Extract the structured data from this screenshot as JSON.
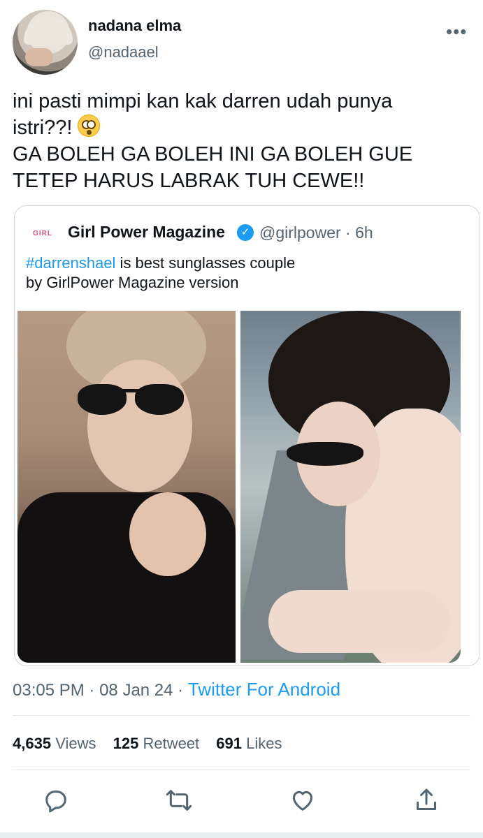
{
  "author": {
    "name": "nadana elma",
    "handle": "@nadaael"
  },
  "more_icon": "more-dots-icon",
  "tweet": {
    "line1": "ini pasti mimpi kan kak darren udah punya",
    "line2": "istri??!",
    "emoji": "flushed-face-emoji",
    "line3": "GA BOLEH GA BOLEH INI GA BOLEH GUE",
    "line4": "TETEP HARUS LABRAK TUH CEWE!!"
  },
  "quote": {
    "logo_text": "GIRL",
    "name": "Girl Power Magazine",
    "verified_icon": "verified-badge-icon",
    "handle_time": "@girlpower · 6h",
    "hashtag": "#darrenshael",
    "text_rest": " is best sunglasses couple",
    "text_line2": "by GirlPower Magazine version",
    "photos": [
      "man-in-sunglasses-photo",
      "woman-in-sunglasses-photo"
    ]
  },
  "meta": {
    "time": "03:05 PM",
    "date": "08 Jan 24",
    "source": "Twitter For Android"
  },
  "stats": {
    "views_count": "4,635",
    "views_label": "Views",
    "retweets_count": "125",
    "retweets_label": "Retweet",
    "likes_count": "691",
    "likes_label": "Likes"
  },
  "actions": [
    "reply-icon",
    "retweet-icon",
    "like-icon",
    "share-icon"
  ],
  "colors": {
    "link": "#1d9bf0",
    "secondary_text": "#536471",
    "primary_text": "#0f1419"
  }
}
